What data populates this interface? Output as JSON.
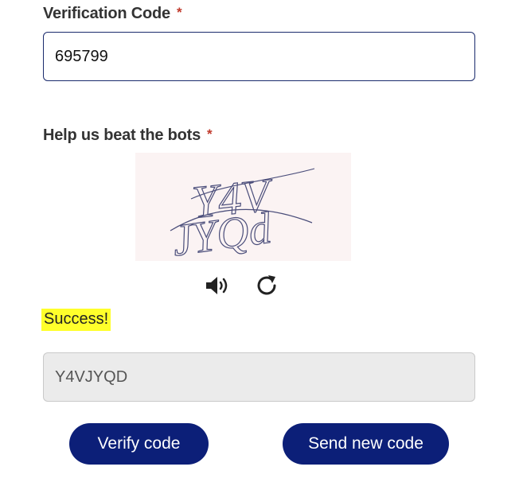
{
  "verification": {
    "label": "Verification Code",
    "required_mark": "*",
    "value": "695799"
  },
  "captcha": {
    "label": "Help us beat the bots",
    "required_mark": "*",
    "image_text_line1": "Y4V",
    "image_text_line2": "JYQd",
    "audio_icon": "speaker-icon",
    "refresh_icon": "refresh-icon",
    "status": "Success!",
    "answer_value": "Y4VJYQD"
  },
  "buttons": {
    "verify": "Verify code",
    "resend": "Send new code"
  },
  "colors": {
    "primary": "#0c1f78",
    "required": "#c0392b",
    "success_highlight": "#ffff2b"
  }
}
